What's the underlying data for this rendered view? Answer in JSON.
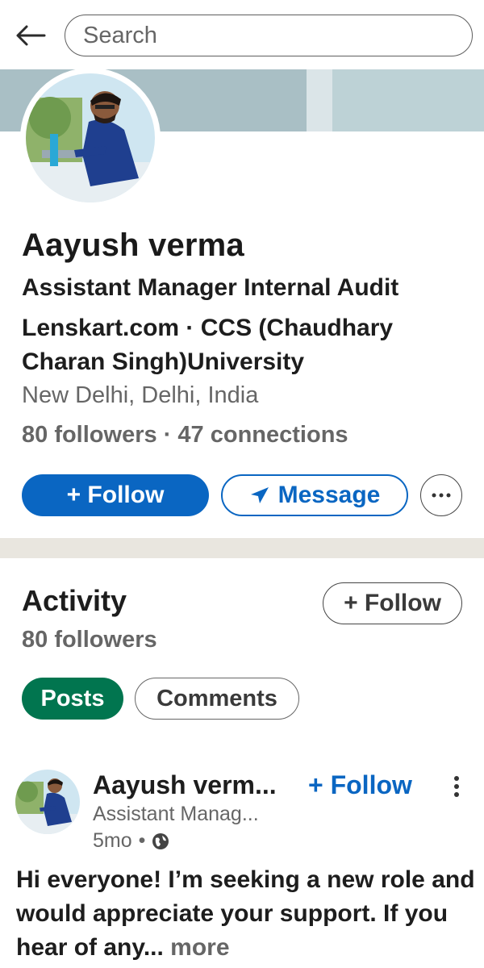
{
  "search": {
    "placeholder": "Search"
  },
  "profile": {
    "name": "Aayush verma",
    "headline": "Assistant Manager Internal Audit",
    "company_line": "Lenskart.com · CCS (Chaudhary Charan Singh)University",
    "location": "New Delhi, Delhi, India",
    "followers": "80 followers",
    "separator": "·",
    "connections": "47 connections"
  },
  "actions": {
    "follow_label": "+ Follow",
    "message_label": "Message",
    "more_icon": "ellipsis-icon"
  },
  "activity": {
    "title": "Activity",
    "followers": "80 followers",
    "follow_label": "+ Follow",
    "tabs": [
      {
        "label": "Posts",
        "selected": true
      },
      {
        "label": "Comments",
        "selected": false
      }
    ]
  },
  "post": {
    "author": "Aayush verm...",
    "follow_label": "+ Follow",
    "subtitle": "Assistant Manag...",
    "time": "5mo",
    "bullet": "•",
    "visibility_icon": "globe-icon",
    "body": "Hi everyone! I’m seeking a new role and would appreciate your support. If you hear of any...",
    "more_label": "more"
  },
  "colors": {
    "brand_blue": "#0a66c2",
    "posts_chip_green": "#01754f",
    "cover": "#a9bfc5",
    "divider": "#e9e6df"
  }
}
